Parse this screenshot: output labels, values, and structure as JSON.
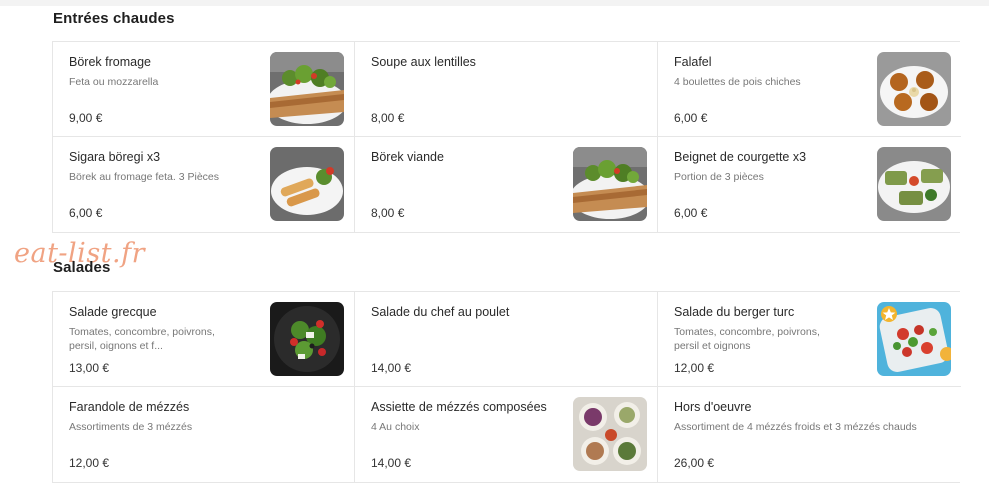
{
  "sections": [
    {
      "title": "Entrées chaudes",
      "items": [
        {
          "name": "Börek fromage",
          "description": "Feta ou mozzarella",
          "price": "9,00 €",
          "image": "borek-salad-image"
        },
        {
          "name": "Soupe aux lentilles",
          "description": "",
          "price": "8,00 €"
        },
        {
          "name": "Falafel",
          "description": "4 boulettes de pois chiches",
          "price": "6,00 €",
          "image": "falafel-image"
        },
        {
          "name": "Sigara böregi x3",
          "description": "Börek au fromage feta. 3 Pièces",
          "price": "6,00 €",
          "image": "sigara-boregi-image"
        },
        {
          "name": "Börek viande",
          "description": "",
          "price": "8,00 €",
          "image": "borek-viande-image"
        },
        {
          "name": "Beignet de courgette x3",
          "description": "Portion de 3 pièces",
          "price": "6,00 €",
          "image": "beignet-courgette-image"
        }
      ]
    },
    {
      "title": "Salades",
      "items": [
        {
          "name": "Salade grecque",
          "description": "Tomates, concombre, poivrons, persil, oignons et f...",
          "price": "13,00 €",
          "image": "salade-grecque-image"
        },
        {
          "name": "Salade du chef au poulet",
          "description": "",
          "price": "14,00 €"
        },
        {
          "name": "Salade du berger turc",
          "description": "Tomates, concombre, poivrons, persil et oignons",
          "price": "12,00 €",
          "image": "salade-berger-image"
        },
        {
          "name": "Farandole de mézzés",
          "description": "Assortiments de 3 mézzés",
          "price": "12,00 €"
        },
        {
          "name": "Assiette de mézzés composées",
          "description": "4 Au choix",
          "price": "14,00 €",
          "image": "mezzes-image"
        },
        {
          "name": "Hors d'oeuvre",
          "description": "Assortiment de 4 mézzés froids et 3 mézzés chauds",
          "price": "26,00 €"
        }
      ]
    }
  ],
  "watermark": "eat-list.fr",
  "colors": {
    "accent_watermark": "#f0a383",
    "border": "#e6e6e6",
    "text": "#2a2a2a",
    "muted": "#777777"
  }
}
